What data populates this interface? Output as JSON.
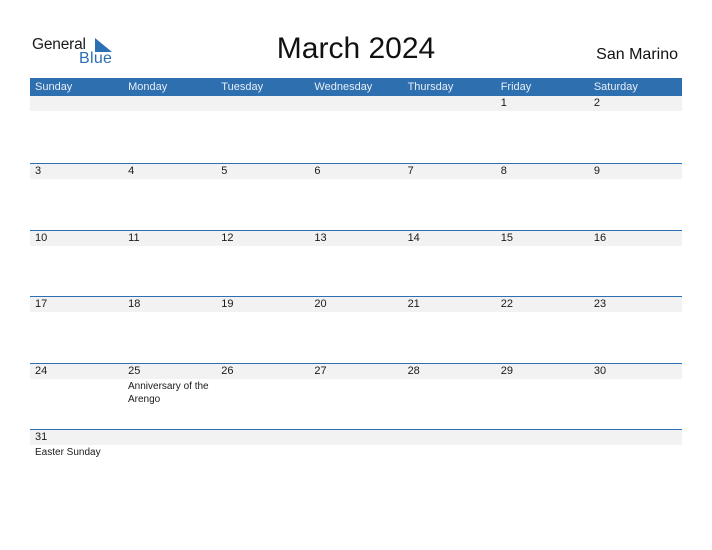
{
  "logo": {
    "general": "General",
    "blue": "Blue",
    "icon": "triangle-flag-icon"
  },
  "title": "March 2024",
  "country": "San Marino",
  "colors": {
    "header": "#2e6fb0",
    "brand": "#2c6fb3",
    "daybar": "#f2f2f2"
  },
  "weekdays": [
    "Sunday",
    "Monday",
    "Tuesday",
    "Wednesday",
    "Thursday",
    "Friday",
    "Saturday"
  ],
  "weeks": [
    {
      "days": [
        "",
        "",
        "",
        "",
        "",
        "1",
        "2"
      ],
      "events": [
        "",
        "",
        "",
        "",
        "",
        "",
        ""
      ]
    },
    {
      "days": [
        "3",
        "4",
        "5",
        "6",
        "7",
        "8",
        "9"
      ],
      "events": [
        "",
        "",
        "",
        "",
        "",
        "",
        ""
      ]
    },
    {
      "days": [
        "10",
        "11",
        "12",
        "13",
        "14",
        "15",
        "16"
      ],
      "events": [
        "",
        "",
        "",
        "",
        "",
        "",
        ""
      ]
    },
    {
      "days": [
        "17",
        "18",
        "19",
        "20",
        "21",
        "22",
        "23"
      ],
      "events": [
        "",
        "",
        "",
        "",
        "",
        "",
        ""
      ]
    },
    {
      "days": [
        "24",
        "25",
        "26",
        "27",
        "28",
        "29",
        "30"
      ],
      "events": [
        "",
        "Anniversary of the Arengo",
        "",
        "",
        "",
        "",
        ""
      ]
    },
    {
      "days": [
        "31",
        "",
        "",
        "",
        "",
        "",
        ""
      ],
      "events": [
        "Easter Sunday",
        "",
        "",
        "",
        "",
        "",
        ""
      ]
    }
  ]
}
